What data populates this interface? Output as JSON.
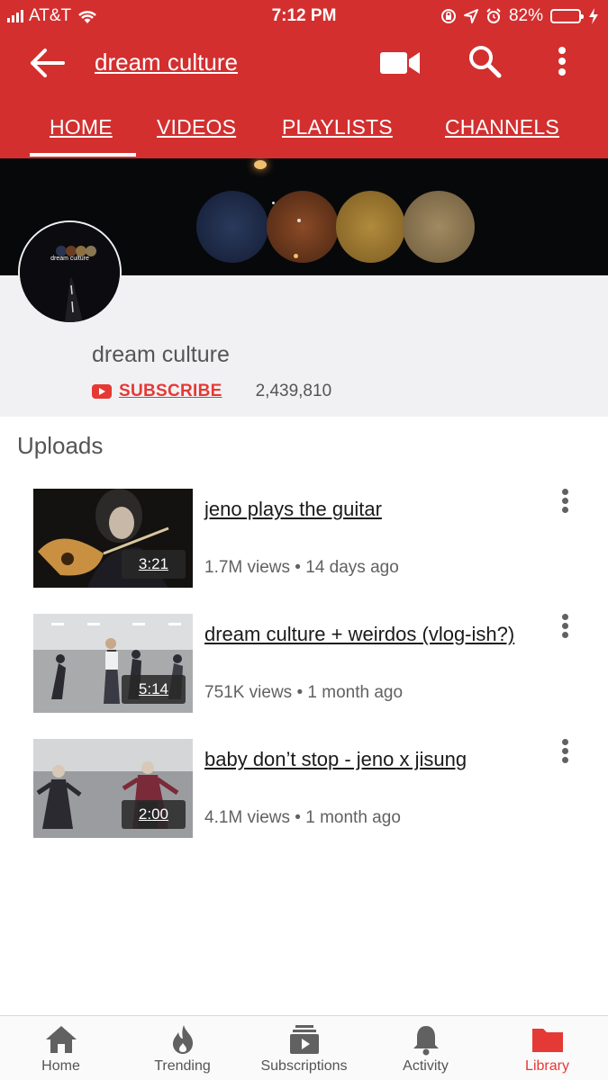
{
  "status_bar": {
    "carrier": "AT&T",
    "time": "7:12 PM",
    "battery": "82%",
    "battery_level": 0.82
  },
  "app_bar": {
    "title": "dream culture",
    "tabs": [
      {
        "label": "HOME",
        "active": true
      },
      {
        "label": "VIDEOS",
        "active": false
      },
      {
        "label": "PLAYLISTS",
        "active": false
      },
      {
        "label": "CHANNELS",
        "active": false
      }
    ]
  },
  "channel": {
    "avatar_text": "dream culture",
    "name": "dream culture",
    "subscribe_label": "SUBSCRIBE",
    "subscriber_count": "2,439,810"
  },
  "uploads": {
    "heading": "Uploads",
    "videos": [
      {
        "title": "jeno plays the guitar",
        "duration": "3:21",
        "views": "1.7M views",
        "age": "14 days ago"
      },
      {
        "title": "dream culture + weirdos (vlog-ish?)",
        "duration": "5:14",
        "views": "751K views",
        "age": "1 month ago"
      },
      {
        "title": "baby don’t stop - jeno x jisung",
        "duration": "2:00",
        "views": "4.1M views",
        "age": "1 month ago"
      }
    ]
  },
  "bottom_nav": {
    "items": [
      {
        "label": "Home",
        "icon": "home-icon"
      },
      {
        "label": "Trending",
        "icon": "flame-icon"
      },
      {
        "label": "Subscriptions",
        "icon": "subscriptions-icon"
      },
      {
        "label": "Activity",
        "icon": "bell-icon"
      },
      {
        "label": "Library",
        "icon": "folder-icon",
        "active": true
      }
    ]
  },
  "colors": {
    "brand_red": "#d32f2f",
    "accent_red": "#e53935",
    "battery_green": "#4cd964"
  }
}
